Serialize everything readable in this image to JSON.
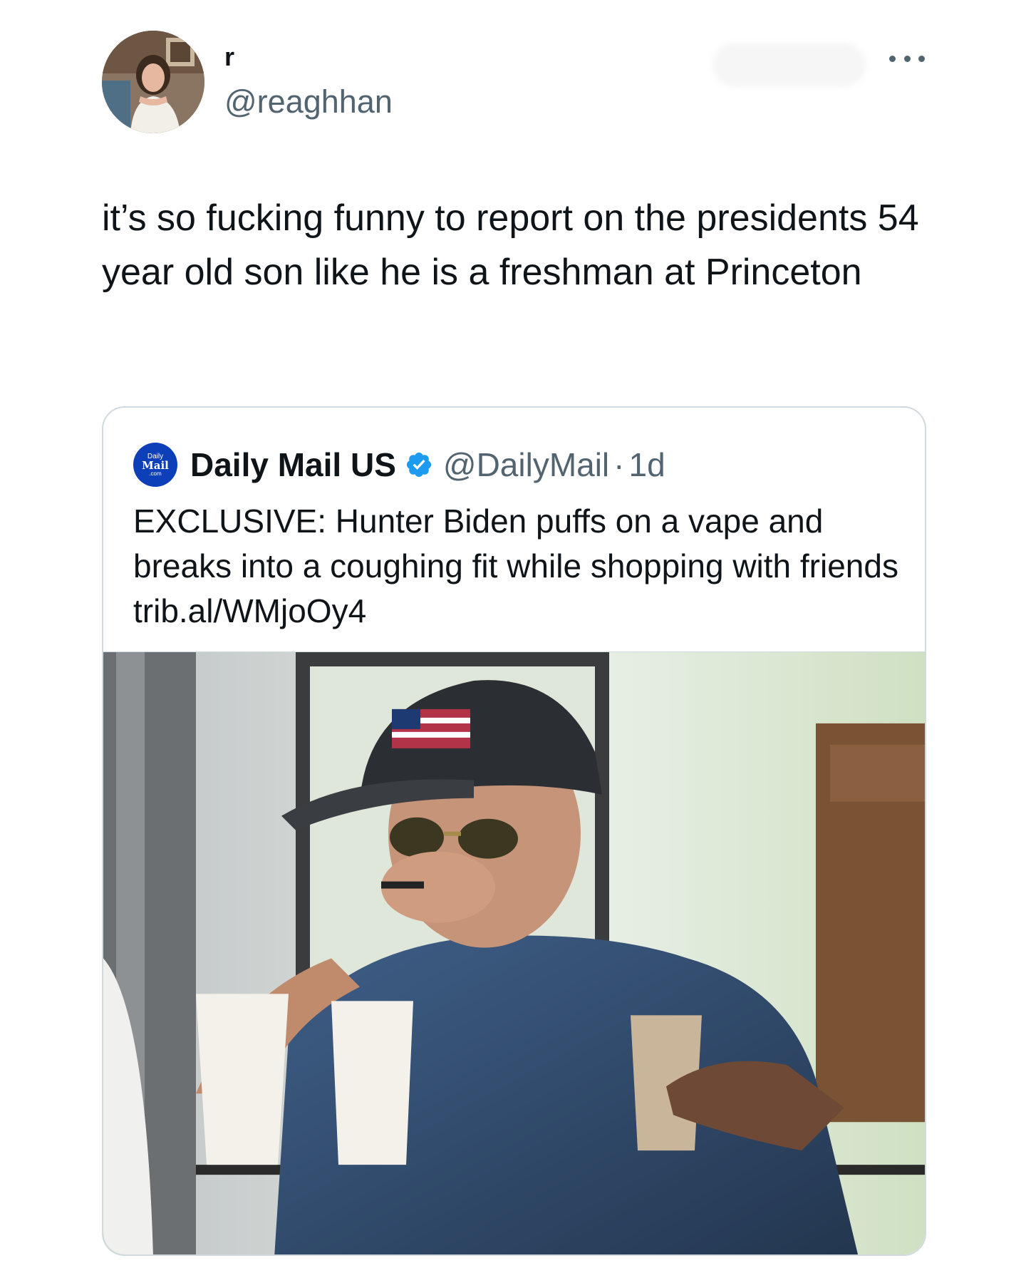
{
  "author": {
    "display_name": "r",
    "handle": "@reaghhan",
    "avatar_icon": "profile-photo"
  },
  "tweet": {
    "text": "it’s so fucking funny to report on the presidents 54 year old son like he is a freshman at Princeton"
  },
  "more_icon": "more-horizontal-icon",
  "quote": {
    "logo": {
      "line1": "Daily",
      "line2": "Mail",
      "line3": ".com"
    },
    "display_name": "Daily Mail US",
    "verified_icon": "verified-badge-icon",
    "handle": "@DailyMail",
    "separator": "·",
    "time": "1d",
    "text": "EXCLUSIVE: Hunter Biden puffs on a vape and breaks into a coughing fit while shopping with friends trib.al/WMjoOy4",
    "media_icon": "photo-man-in-cap-with-coffee-cups"
  },
  "colors": {
    "text_primary": "#0f1419",
    "text_secondary": "#536471",
    "border": "#cfd9de",
    "verified": "#1d9bf0",
    "dailymail_blue": "#0d3fb8"
  }
}
